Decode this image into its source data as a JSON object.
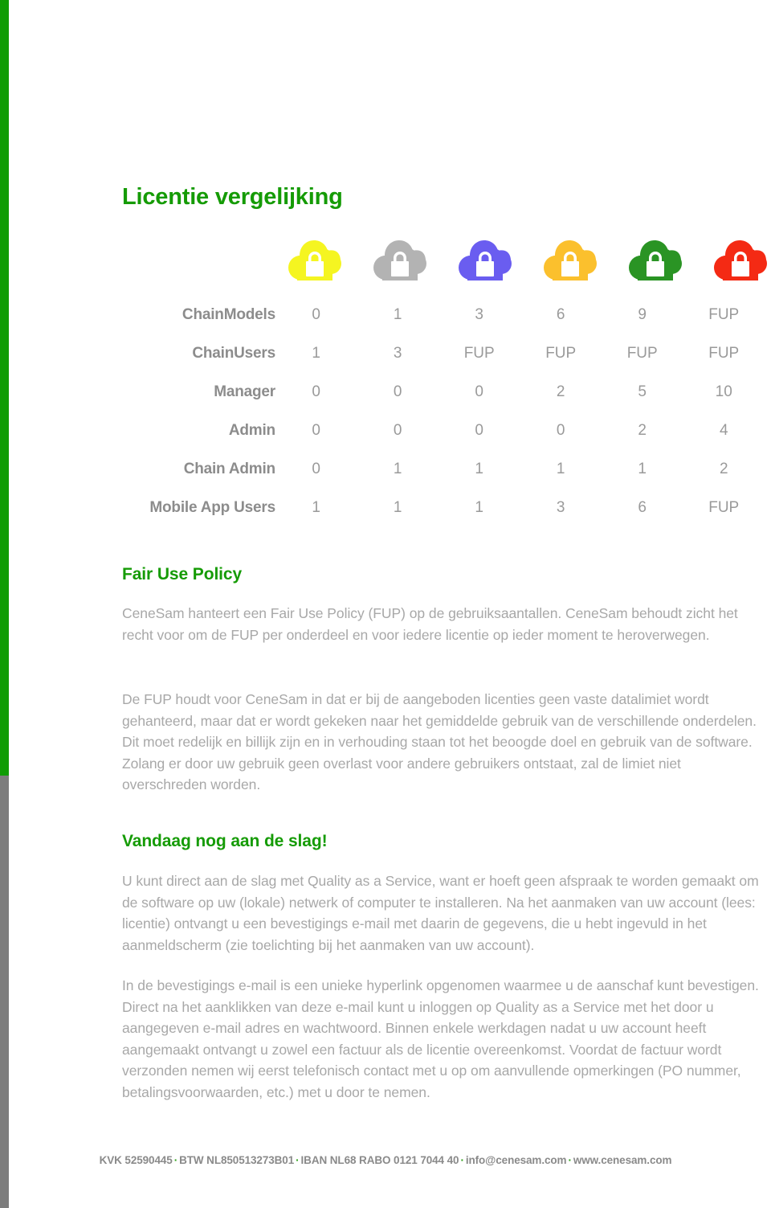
{
  "document": {
    "title": "Licentie vergelijking",
    "heading_color": "#159b05"
  },
  "edge_bars": {
    "green_color": "#109c04",
    "gray_color": "#7d7d7d"
  },
  "license_icons": [
    {
      "name": "cloud-lock-icon-yellow",
      "color": "#f5f521",
      "label": "Yellow license tier"
    },
    {
      "name": "cloud-lock-icon-gray",
      "color": "#b3b3b3",
      "label": "Gray license tier"
    },
    {
      "name": "cloud-lock-icon-purple",
      "color": "#6a5df0",
      "label": "Purple license tier"
    },
    {
      "name": "cloud-lock-icon-orange",
      "color": "#fbc02d",
      "label": "Orange license tier"
    },
    {
      "name": "cloud-lock-icon-green",
      "color": "#2a9424",
      "label": "Green license tier"
    },
    {
      "name": "cloud-lock-icon-red",
      "color": "#f42a14",
      "label": "Red license tier"
    }
  ],
  "comparison_table": {
    "rows": [
      {
        "label": "ChainModels",
        "values": [
          "0",
          "1",
          "3",
          "6",
          "9",
          "FUP"
        ]
      },
      {
        "label": "ChainUsers",
        "values": [
          "1",
          "3",
          "FUP",
          "FUP",
          "FUP",
          "FUP"
        ]
      },
      {
        "label": "Manager",
        "values": [
          "0",
          "0",
          "0",
          "2",
          "5",
          "10"
        ]
      },
      {
        "label": "Admin",
        "values": [
          "0",
          "0",
          "0",
          "0",
          "2",
          "4"
        ]
      },
      {
        "label": "Chain Admin",
        "values": [
          "0",
          "1",
          "1",
          "1",
          "1",
          "2"
        ]
      },
      {
        "label": "Mobile App Users",
        "values": [
          "1",
          "1",
          "1",
          "3",
          "6",
          "FUP"
        ]
      }
    ]
  },
  "sections": {
    "fair_use": {
      "heading": "Fair Use Policy",
      "paragraphs": [
        "CeneSam hanteert een Fair Use Policy (FUP) op de gebruiksaantallen. CeneSam behoudt zicht het recht voor om de FUP per onderdeel en voor iedere licentie op ieder moment te heroverwegen.",
        "De FUP houdt voor CeneSam in dat er bij de aangeboden licenties geen vaste datalimiet wordt gehanteerd, maar dat er wordt gekeken naar het gemiddelde gebruik van de verschillende onderdelen. Dit moet redelijk en billijk zijn en in verhouding staan tot het beoogde doel en gebruik van de software. Zolang er door uw gebruik geen overlast voor andere gebruikers ontstaat, zal de limiet niet overschreden worden."
      ]
    },
    "get_started": {
      "heading": "Vandaag nog aan de slag!",
      "paragraphs": [
        "U kunt direct aan de slag met Quality as a Service, want er hoeft geen afspraak te worden gemaakt om de software op uw (lokale) netwerk of computer te installeren. Na het aanmaken van uw account (lees: licentie) ontvangt u een bevestigings e-mail met daarin de gegevens, die u hebt ingevuld in het aanmeldscherm (zie toelichting bij het aanmaken van uw account).",
        "In de bevestigings e-mail is een unieke hyperlink opgenomen waarmee u de aanschaf kunt bevestigen. Direct na het aanklikken van deze e-mail kunt u inloggen op Quality as a Service met het door u aangegeven e-mail adres en wachtwoord. Binnen enkele werkdagen nadat u uw account heeft aangemaakt ontvangt u zowel een factuur als de licentie overeenkomst. Voordat de factuur wordt verzonden nemen wij eerst telefonisch contact met u op om aanvullende opmerkingen (PO nummer, betalingsvoorwaarden, etc.) met u door te nemen."
      ]
    }
  },
  "footer": {
    "separator": "·",
    "separator_color": "#2fa11a",
    "items": [
      "KVK 52590445",
      "BTW NL850513273B01",
      "IBAN NL68 RABO 0121 7044 40",
      "info@cenesam.com",
      "www.cenesam.com"
    ]
  }
}
